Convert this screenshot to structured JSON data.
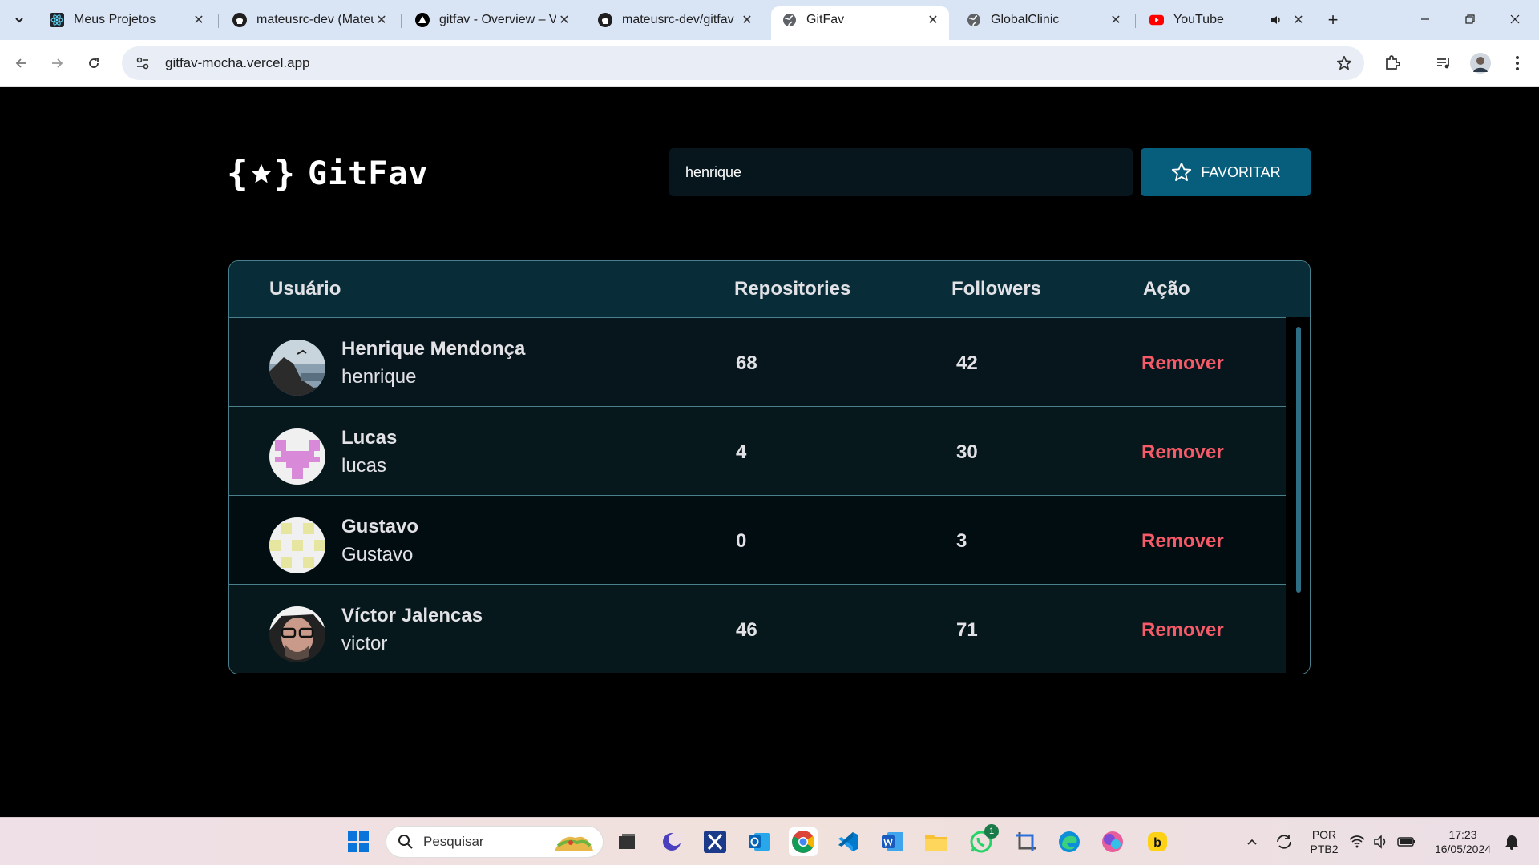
{
  "browser": {
    "tabs": [
      {
        "title": "Meus Projetos",
        "icon": "react-icon"
      },
      {
        "title": "mateusrc-dev (Mateus",
        "icon": "github-icon"
      },
      {
        "title": "gitfav - Overview – V",
        "icon": "vercel-icon"
      },
      {
        "title": "mateusrc-dev/gitfav",
        "icon": "github-icon"
      },
      {
        "title": "GitFav",
        "icon": "globe-icon",
        "active": true
      },
      {
        "title": "GlobalClinic",
        "icon": "globe-icon"
      },
      {
        "title": "YouTube",
        "icon": "youtube-icon",
        "audio": true
      }
    ],
    "url": "gitfav-mocha.vercel.app"
  },
  "app": {
    "brand_open": "{",
    "brand_close": "}",
    "brand_name": "GitFav",
    "search_value": "henrique",
    "favorite_label": "FAVORITAR"
  },
  "table": {
    "headers": {
      "user": "Usuário",
      "repos": "Repositories",
      "followers": "Followers",
      "action": "Ação"
    },
    "rows": [
      {
        "name": "Henrique Mendonça",
        "login": "henrique",
        "repos": "68",
        "followers": "42",
        "action": "Remover"
      },
      {
        "name": "Lucas",
        "login": "lucas",
        "repos": "4",
        "followers": "30",
        "action": "Remover"
      },
      {
        "name": "Gustavo",
        "login": "Gustavo",
        "repos": "0",
        "followers": "3",
        "action": "Remover"
      },
      {
        "name": "Víctor Jalencas",
        "login": "victor",
        "repos": "46",
        "followers": "71",
        "action": "Remover"
      }
    ]
  },
  "taskbar": {
    "search_placeholder": "Pesquisar",
    "lang_1": "POR",
    "lang_2": "PTB2",
    "time": "17:23",
    "date": "16/05/2024",
    "whatsapp_badge": "1"
  },
  "colors": {
    "accent": "#065e7c",
    "remove": "#f75a68",
    "table_header": "#092d38",
    "border": "#4a808c"
  }
}
